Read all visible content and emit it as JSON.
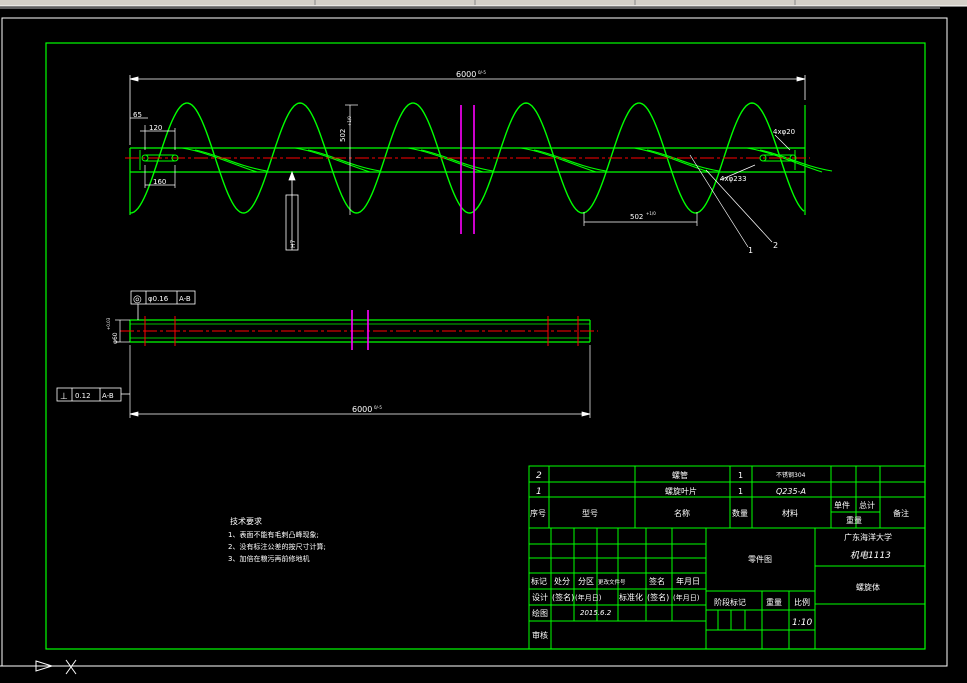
{
  "dims": {
    "top_length": "6000",
    "top_tol": "0/-5",
    "left_65": "65",
    "left_120": "120",
    "left_160": "160",
    "pitch_right": "502",
    "pitch_right_tol": "+1/0",
    "vertical": "502",
    "vertical_tol": "+1/0",
    "hole_right": "4xφ20",
    "hole_233": "4xφ233",
    "section": "H7",
    "bottom_length": "6000",
    "bottom_tol": "0/-5",
    "bottom_dia": "φ60",
    "bottom_dia_tol": "+0.03"
  },
  "gdt": {
    "top_symbol": "◎",
    "top_value": "φ0.16",
    "top_datum": "A-B",
    "left_symbol": "⊥",
    "left_value": "0.12",
    "left_datum": "A-B"
  },
  "leaders": {
    "one": "1",
    "two": "2"
  },
  "notes": {
    "title": "技术要求",
    "line1": "1、表面不能有毛刺凸峰现象;",
    "line2": "2、没有标注公差的按尺寸计算;",
    "line3": "3、加倍在粮污再前修地机"
  },
  "bom": {
    "r2_no": "2",
    "r2_name": "螺管",
    "r2_qty": "1",
    "r2_mat": "不锈钢304",
    "r1_no": "1",
    "r1_name": "螺旋叶片",
    "r1_qty": "1",
    "r1_mat": "Q235-A",
    "h_no": "序号",
    "h_model": "型号",
    "h_name": "名称",
    "h_qty": "数量",
    "h_mat": "材料",
    "h_unit": "单件",
    "h_total": "总计",
    "h_weight": "重量",
    "h_remark": "备注"
  },
  "title_block": {
    "lbl_mark": "标记",
    "lbl_count": "处分",
    "lbl_zone": "分区",
    "lbl_docno": "更改文件号",
    "lbl_sign": "签名",
    "lbl_date": "年月日",
    "lbl_design": "设计",
    "val_sign": "(签名)",
    "val_date": "(年月日)",
    "lbl_std": "标准化",
    "val_sign2": "(签名)",
    "val_date2": "(年月日)",
    "lbl_draw": "绘图",
    "draw_date": "2015.6.2",
    "lbl_review": "审核",
    "lbl_stage": "阶段标记",
    "lbl_weight": "重量",
    "lbl_scale": "比例",
    "scale": "1:10",
    "part_drawing": "零件图",
    "school": "广东海洋大学",
    "class": "机电1113",
    "title": "螺旋体"
  },
  "colors": {
    "border": "#00ff00",
    "center": "#ff0000",
    "flange": "#ff00ff",
    "dim": "#ffffff"
  }
}
